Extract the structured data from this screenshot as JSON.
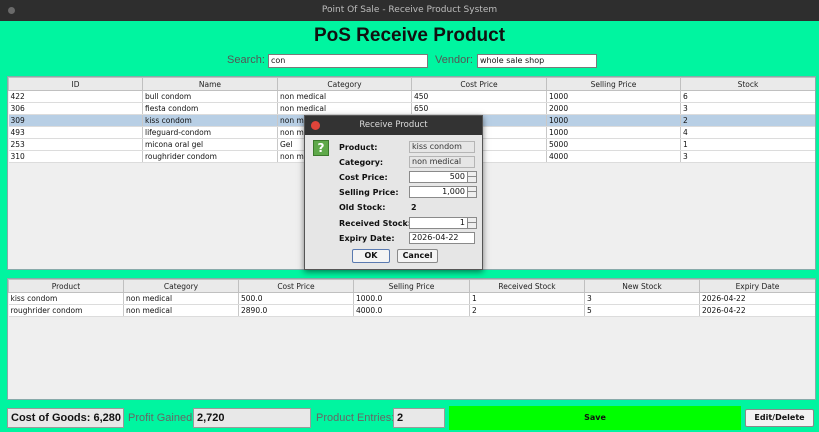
{
  "window": {
    "title": "Point Of Sale - Receive Product System"
  },
  "app_title": "PoS Receive Product",
  "search": {
    "label": "Search:",
    "value": "con"
  },
  "vendor": {
    "label": "Vendor:",
    "value": "whole sale shop"
  },
  "products_table": {
    "columns": [
      "ID",
      "Name",
      "Category",
      "Cost Price",
      "Selling Price",
      "Stock"
    ],
    "rows": [
      [
        "422",
        "bull condom",
        "non medical",
        "450",
        "1000",
        "6"
      ],
      [
        "306",
        "fiesta condom",
        "non medical",
        "650",
        "2000",
        "3"
      ],
      [
        "309",
        "kiss condom",
        "non me",
        "",
        "1000",
        "2"
      ],
      [
        "493",
        "lifeguard-condom",
        "non me",
        "",
        "1000",
        "4"
      ],
      [
        "253",
        "micona oral gel",
        "Gel",
        "",
        "5000",
        "1"
      ],
      [
        "310",
        "roughrider condom",
        "non me",
        "",
        "4000",
        "3"
      ]
    ],
    "selected_row": 2
  },
  "entries_table": {
    "columns": [
      "Product",
      "Category",
      "Cost Price",
      "Selling Price",
      "Received Stock",
      "New Stock",
      "Expiry Date"
    ],
    "rows": [
      [
        "kiss condom",
        "non medical",
        "500.0",
        "1000.0",
        "1",
        "3",
        "2026-04-22"
      ],
      [
        "roughrider condom",
        "non medical",
        "2890.0",
        "4000.0",
        "2",
        "5",
        "2026-04-22"
      ]
    ]
  },
  "footer": {
    "cost_of_goods": "Cost of Goods: 6,280",
    "profit_label": "Profit Gained:",
    "profit_value": "2,720",
    "entries_label": "Product Entries:",
    "entries_value": "2",
    "save_label": "Save",
    "edit_label": "Edit/Delete"
  },
  "dialog": {
    "title": "Receive Product",
    "icon": "question-icon",
    "icon_glyph": "?",
    "product_label": "Product:",
    "product_value": "kiss condom",
    "category_label": "Category:",
    "category_value": "non medical",
    "cost_label": "Cost Price:",
    "cost_value": "500",
    "selling_label": "Selling Price:",
    "selling_value": "1,000",
    "old_stock_label": "Old Stock:",
    "old_stock_value": "2",
    "received_label": "Received Stock:",
    "received_value": "1",
    "expiry_label": "Expiry Date:",
    "expiry_value": "2026-04-22",
    "ok_label": "OK",
    "cancel_label": "Cancel"
  },
  "colors": {
    "background": "#00f5a0",
    "save_button": "#00ff00",
    "selection": "#b8cfe5",
    "titlebar": "#2e2e2e"
  }
}
